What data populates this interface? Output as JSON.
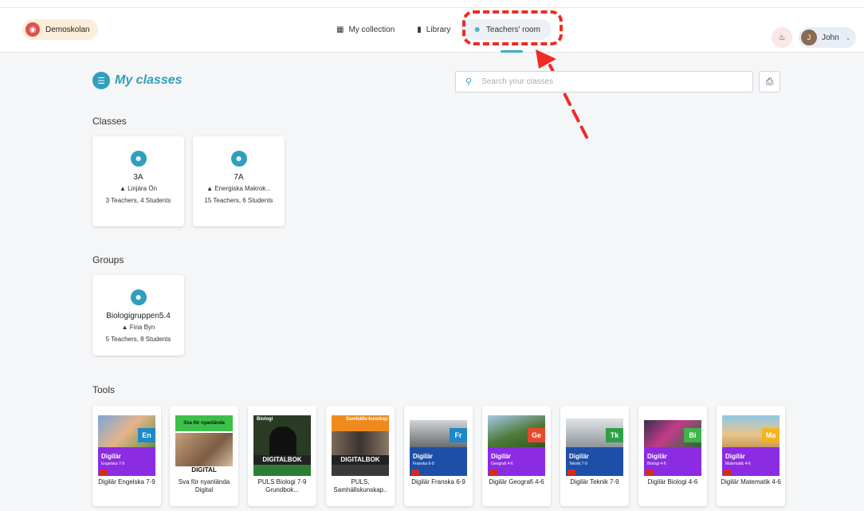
{
  "header": {
    "school_name": "Demoskolan",
    "nav": [
      {
        "label": "My collection",
        "icon": "grid-icon"
      },
      {
        "label": "Library",
        "icon": "book-icon"
      },
      {
        "label": "Teachers' room",
        "icon": "users-icon"
      }
    ],
    "user_name": "John"
  },
  "page": {
    "title": "My classes",
    "search_placeholder": "Search your classes"
  },
  "sections": {
    "classes": "Classes",
    "groups": "Groups",
    "tools": "Tools"
  },
  "classes": [
    {
      "name": "3A",
      "location": "Linjära Ön",
      "members": "3 Teachers, 4 Students"
    },
    {
      "name": "7A",
      "location": "Energiska Makrok...",
      "members": "15 Teachers, 6 Students"
    }
  ],
  "groups": [
    {
      "name": "Biologigruppen5.4",
      "location": "Fina Byn",
      "members": "5 Teachers, 8 Students"
    }
  ],
  "tools": [
    {
      "name": "Digilär Engelska 7-9",
      "badge": "En",
      "subtitle": "Engelska 7-9",
      "color": "#1e88c8"
    },
    {
      "name": "Sva för nyanlända Digital",
      "cover_top": "Sva för nyanlända",
      "cover_bottom": "DIGITAL",
      "color": "#3cc04a"
    },
    {
      "name": "PULS Biologi 7-9 Grundbok...",
      "cover_top": "Biologi",
      "cover_bottom": "DIGITALBOK",
      "color": "#2e7d32"
    },
    {
      "name": "PULS, Samhällskunskap..",
      "cover_top": "Samhälls-kunskap",
      "cover_bottom": "DIGITALBOK",
      "color": "#f08a1c"
    },
    {
      "name": "Digilär Franska 6-9",
      "badge": "Fr",
      "subtitle": "Franska 6-9",
      "color": "#1e88c8"
    },
    {
      "name": "Digilär Geografi 4-6",
      "badge": "Ge",
      "subtitle": "Geografi 4-6",
      "color": "#e8492b"
    },
    {
      "name": "Digilär Teknik 7-9",
      "badge": "Tk",
      "subtitle": "Teknik 7-9",
      "color": "#2e9f47"
    },
    {
      "name": "Digilär Biologi 4-6",
      "badge": "Bi",
      "subtitle": "Biologi 4-6",
      "color": "#3cb54a"
    },
    {
      "name": "Digilär Matematik 4-6",
      "badge": "Ma",
      "subtitle": "Matematik 4-6",
      "color": "#f5b41c"
    }
  ],
  "brand": "Digilär",
  "colors": {
    "accent": "#2f9fbd",
    "annotation": "#ee2b24",
    "digilar_band": "#8b2be2"
  }
}
